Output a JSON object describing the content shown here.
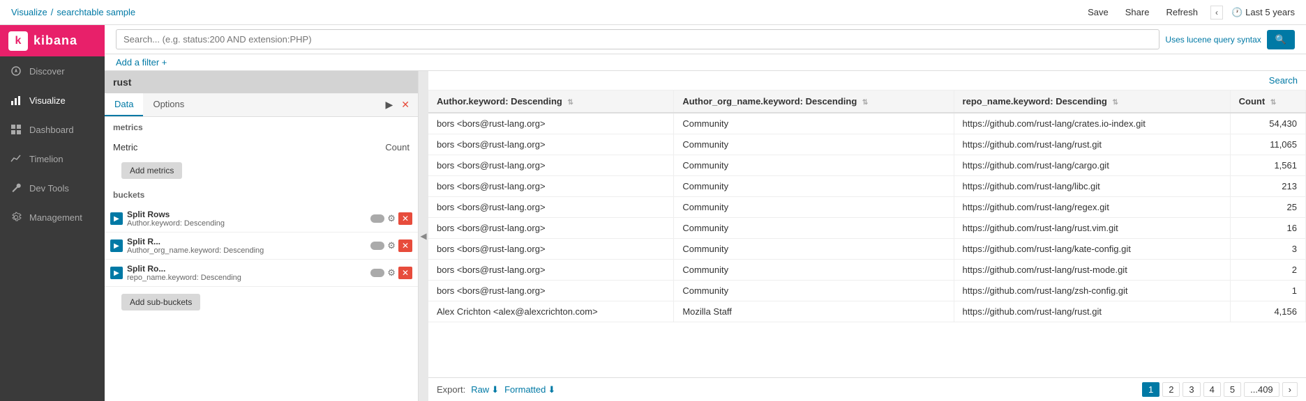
{
  "sidebar": {
    "logo_text": "kibana",
    "items": [
      {
        "id": "discover",
        "label": "Discover",
        "icon": "compass"
      },
      {
        "id": "visualize",
        "label": "Visualize",
        "icon": "bar-chart"
      },
      {
        "id": "dashboard",
        "label": "Dashboard",
        "icon": "grid"
      },
      {
        "id": "timelion",
        "label": "Timelion",
        "icon": "chart-line"
      },
      {
        "id": "dev-tools",
        "label": "Dev Tools",
        "icon": "wrench"
      },
      {
        "id": "management",
        "label": "Management",
        "icon": "gear"
      }
    ]
  },
  "breadcrumb": {
    "parent": "Visualize",
    "separator": "/",
    "current": "searchtable sample"
  },
  "nav_actions": {
    "save": "Save",
    "share": "Share",
    "refresh": "Refresh",
    "time_range": "Last 5 years"
  },
  "search": {
    "placeholder": "Search... (e.g. status:200 AND extension:PHP)",
    "value": "",
    "lucene_hint": "Uses lucene query syntax",
    "button": "🔍"
  },
  "filter": {
    "add_label": "Add a filter +"
  },
  "left_panel": {
    "title": "rust",
    "tabs": [
      {
        "id": "data",
        "label": "Data",
        "active": true
      },
      {
        "id": "options",
        "label": "Options",
        "active": false
      }
    ],
    "metrics_section": {
      "label": "metrics",
      "items": [
        {
          "name": "Metric",
          "value": "Count"
        }
      ],
      "add_button": "Add metrics"
    },
    "buckets_section": {
      "label": "buckets",
      "items": [
        {
          "type": "Split Rows",
          "detail": "Author.keyword: Descending"
        },
        {
          "type": "Split R...",
          "detail": "Author_org_name.keyword: Descending"
        },
        {
          "type": "Split Ro...",
          "detail": "repo_name.keyword: Descending"
        }
      ],
      "add_sub_button": "Add sub-buckets"
    }
  },
  "right_panel": {
    "search_button": "Search",
    "table": {
      "columns": [
        {
          "id": "author",
          "label": "Author.keyword: Descending",
          "sortable": true
        },
        {
          "id": "org",
          "label": "Author_org_name.keyword: Descending",
          "sortable": true
        },
        {
          "id": "repo",
          "label": "repo_name.keyword: Descending",
          "sortable": true
        },
        {
          "id": "count",
          "label": "Count",
          "sortable": true
        }
      ],
      "rows": [
        {
          "author": "bors <bors@rust-lang.org>",
          "org": "Community",
          "repo": "https://github.com/rust-lang/crates.io-index.git",
          "count": "54,430"
        },
        {
          "author": "bors <bors@rust-lang.org>",
          "org": "Community",
          "repo": "https://github.com/rust-lang/rust.git",
          "count": "11,065"
        },
        {
          "author": "bors <bors@rust-lang.org>",
          "org": "Community",
          "repo": "https://github.com/rust-lang/cargo.git",
          "count": "1,561"
        },
        {
          "author": "bors <bors@rust-lang.org>",
          "org": "Community",
          "repo": "https://github.com/rust-lang/libc.git",
          "count": "213"
        },
        {
          "author": "bors <bors@rust-lang.org>",
          "org": "Community",
          "repo": "https://github.com/rust-lang/regex.git",
          "count": "25"
        },
        {
          "author": "bors <bors@rust-lang.org>",
          "org": "Community",
          "repo": "https://github.com/rust-lang/rust.vim.git",
          "count": "16"
        },
        {
          "author": "bors <bors@rust-lang.org>",
          "org": "Community",
          "repo": "https://github.com/rust-lang/kate-config.git",
          "count": "3"
        },
        {
          "author": "bors <bors@rust-lang.org>",
          "org": "Community",
          "repo": "https://github.com/rust-lang/rust-mode.git",
          "count": "2"
        },
        {
          "author": "bors <bors@rust-lang.org>",
          "org": "Community",
          "repo": "https://github.com/rust-lang/zsh-config.git",
          "count": "1"
        },
        {
          "author": "Alex Crichton <alex@alexcrichton.com>",
          "org": "Mozilla Staff",
          "repo": "https://github.com/rust-lang/rust.git",
          "count": "4,156"
        }
      ]
    },
    "export": {
      "label": "Export:",
      "raw": "Raw",
      "formatted": "Formatted"
    },
    "pagination": {
      "pages": [
        "1",
        "2",
        "3",
        "4",
        "5",
        "...409"
      ],
      "next_icon": "›"
    }
  }
}
